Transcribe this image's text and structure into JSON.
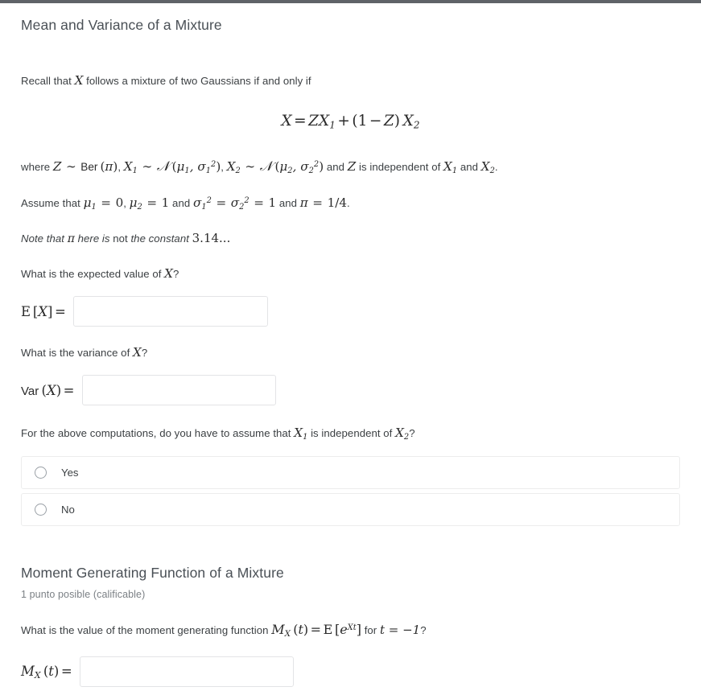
{
  "sections": [
    {
      "title": "Mean and Variance of a Mixture",
      "intro": "Recall that",
      "intro_tail": "follows a mixture of two Gaussians if and only if",
      "display_equation": "X = ZX₁ + (1 − Z) X₂",
      "where_line": "where Z ~ Ber (π), X₁ ~ N (μ₁, σ₁²), X₂ ~ N (μ₂, σ₂²) and Z is independent of X₁ and X₂.",
      "assume_line": "Assume that μ₁ = 0, μ₂ = 1 and σ₁² = σ₂² = 1 and π = 1/4.",
      "note_prefix": "Note that",
      "note_pi": "π",
      "note_mid": "here is",
      "note_not": "not",
      "note_tail": "the constant",
      "note_value": "3.14...",
      "q_expected": "What is the expected value of",
      "q_expected_tail": "?",
      "expected_label_e": "E",
      "expected_label_x": "X",
      "expected_value": "",
      "q_variance": "What is the variance of",
      "q_variance_tail": "?",
      "variance_label": "Var",
      "variance_label_x": "X",
      "variance_value": "",
      "q_independence_1": "For the above computations, do you have to assume that",
      "q_independence_2": "is independent of",
      "q_independence_3": "?",
      "choices": [
        {
          "label": "Yes",
          "selected": false
        },
        {
          "label": "No",
          "selected": false
        }
      ]
    },
    {
      "title": "Moment Generating Function of a Mixture",
      "points": "1 punto posible (calificable)",
      "q_mgf_1": "What is the value of the moment generating function",
      "q_mgf_2": "for",
      "q_mgf_3": "?",
      "mgf_label_m": "M",
      "mgf_label_sub": "X",
      "mgf_label_t": "t",
      "mgf_value": ""
    }
  ],
  "symbols": {
    "X": "X",
    "X1_base": "X",
    "X1_sub": "1",
    "X2_base": "X",
    "X2_sub": "2",
    "Z": "Z",
    "t_minus_one": "t = −1"
  },
  "input_placeholder": ""
}
